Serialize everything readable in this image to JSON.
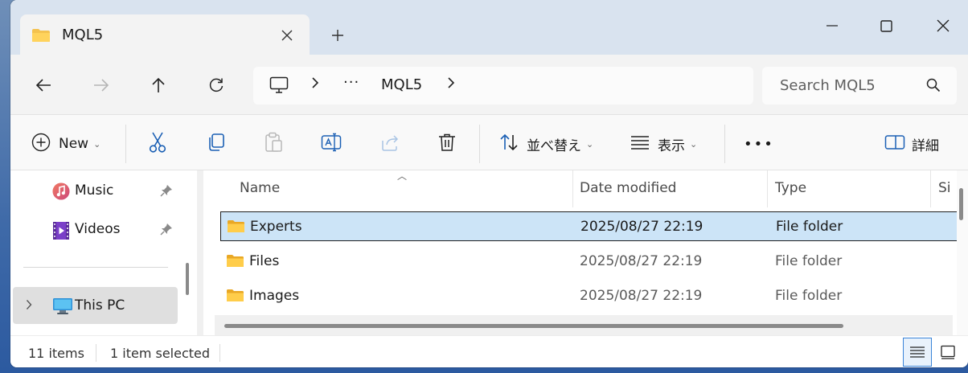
{
  "tab": {
    "title": "MQL5",
    "close_icon": "close-icon",
    "new_tab_icon": "plus-icon"
  },
  "window_controls": {
    "minimize": "minimize-icon",
    "maximize": "maximize-icon",
    "close": "close-icon"
  },
  "nav": {
    "back_icon": "arrow-left-icon",
    "forward_icon": "arrow-right-icon",
    "up_icon": "arrow-up-icon",
    "refresh_icon": "refresh-icon"
  },
  "address": {
    "root_icon": "this-pc-icon",
    "overflow": "···",
    "current": "MQL5"
  },
  "search": {
    "placeholder": "Search MQL5"
  },
  "commands": {
    "new_label": "New",
    "sort_label": "並べ替え",
    "view_label": "表示",
    "more_label": "•••",
    "details_label": "詳細"
  },
  "sidebar": {
    "items": [
      {
        "label": "Music",
        "icon": "music-icon",
        "pinned": true
      },
      {
        "label": "Videos",
        "icon": "videos-icon",
        "pinned": true
      },
      {
        "label": "This PC",
        "icon": "this-pc-icon",
        "selected": true
      }
    ]
  },
  "columns": [
    "Name",
    "Date modified",
    "Type",
    "Si"
  ],
  "files": [
    {
      "name": "Experts",
      "date": "2025/08/27 22:19",
      "type": "File folder",
      "selected": true
    },
    {
      "name": "Files",
      "date": "2025/08/27 22:19",
      "type": "File folder",
      "selected": false
    },
    {
      "name": "Images",
      "date": "2025/08/27 22:19",
      "type": "File folder",
      "selected": false
    }
  ],
  "status": {
    "item_count": "11 items",
    "selection": "1 item selected"
  },
  "colors": {
    "accent": "#0067c0",
    "selection": "#cce4f7",
    "folder": "#f4c24f"
  }
}
